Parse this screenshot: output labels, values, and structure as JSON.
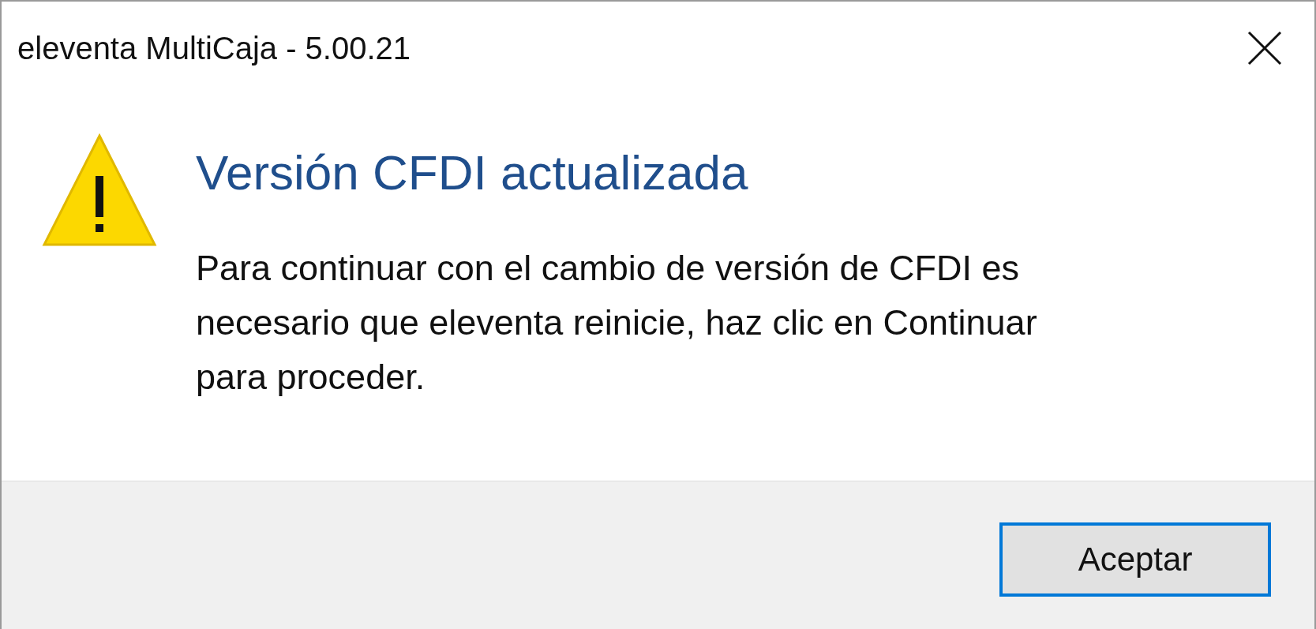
{
  "window": {
    "title": "eleventa MultiCaja - 5.00.21"
  },
  "message": {
    "heading": "Versión CFDI actualizada",
    "body": "Para continuar con el cambio de versión de CFDI es necesario que eleventa reinicie, haz clic en Continuar para proceder."
  },
  "buttons": [
    {
      "label": "Aceptar",
      "selected": true
    }
  ]
}
